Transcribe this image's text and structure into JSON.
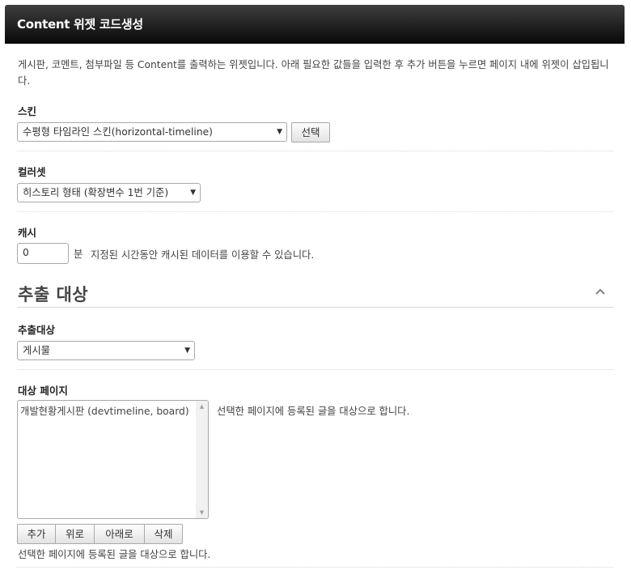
{
  "window": {
    "title": "Content 위젯 코드생성"
  },
  "intro": "게시판, 코멘트, 첨부파일 등 Content를 출력하는 위젯입니다. 아래 필요한 값들을 입력한 후 추가 버튼을 누르면 페이지 내에 위젯이 삽입됩니다.",
  "skin": {
    "label": "스킨",
    "selected": "수평형 타임라인 스킨(horizontal-timeline)",
    "select_button": "선택"
  },
  "colorset": {
    "label": "컬러셋",
    "selected": "히스토리 형태 (확장변수 1번 기준)"
  },
  "cache": {
    "label": "캐시",
    "value": "0",
    "unit": "분",
    "help": "지정된 시간동안 캐시된 데이터를 이용할 수 있습니다."
  },
  "section": {
    "title": "추출 대상",
    "collapse_icon": "chevron-up-icon"
  },
  "target": {
    "label": "추출대상",
    "selected": "게시물"
  },
  "target_pages": {
    "label": "대상 페이지",
    "items": [
      "개발현황게시판 (devtimeline, board)"
    ],
    "help_right": "선택한 페이지에 등록된 글을 대상으로 합니다.",
    "buttons": {
      "add": "추가",
      "up": "위로",
      "down": "아래로",
      "delete": "삭제"
    },
    "help_bottom": "선택한 페이지에 등록된 글을 대상으로 합니다."
  },
  "colors": {
    "titlebar_dark": "#080808",
    "titlebar_light": "#3e3e3e",
    "title_text": "#ffffff",
    "divider": "#d6d6d6"
  }
}
